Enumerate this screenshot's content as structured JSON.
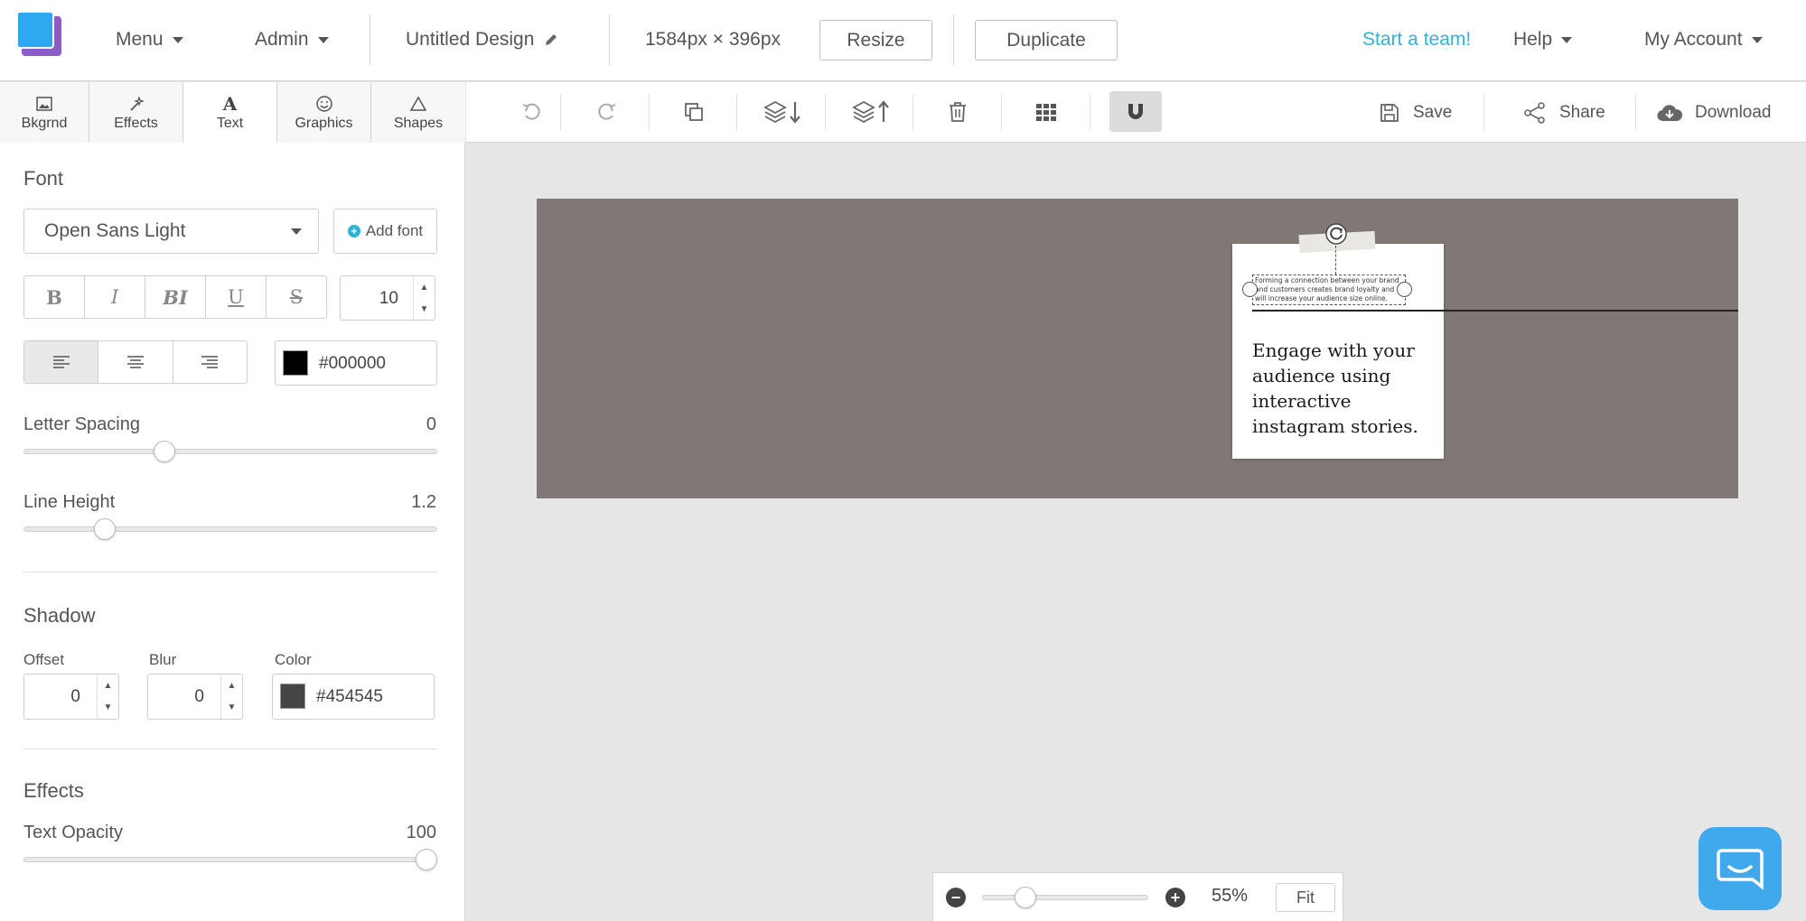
{
  "header": {
    "menu_label": "Menu",
    "admin_label": "Admin",
    "design_title": "Untitled Design",
    "dimensions": "1584px × 396px",
    "resize_label": "Resize",
    "duplicate_label": "Duplicate",
    "team_link": "Start a team!",
    "help_label": "Help",
    "account_label": "My Account"
  },
  "tabs": [
    {
      "label": "Bkgrnd",
      "icon": "image-icon"
    },
    {
      "label": "Effects",
      "icon": "magic-wand-icon"
    },
    {
      "label": "Text",
      "icon": "text-icon"
    },
    {
      "label": "Graphics",
      "icon": "smiley-icon"
    },
    {
      "label": "Shapes",
      "icon": "triangle-icon"
    }
  ],
  "font_panel": {
    "title": "Font",
    "font_name": "Open Sans Light",
    "add_font_label": "Add font",
    "style_buttons": [
      "B",
      "I",
      "BI",
      "U",
      "S"
    ],
    "font_size": "10",
    "color_hex": "#000000",
    "letter_spacing_label": "Letter Spacing",
    "letter_spacing_value": "0",
    "line_height_label": "Line Height",
    "line_height_value": "1.2"
  },
  "shadow_panel": {
    "title": "Shadow",
    "offset_label": "Offset",
    "offset_value": "0",
    "blur_label": "Blur",
    "blur_value": "0",
    "color_label": "Color",
    "color_hex": "#454545"
  },
  "effects_panel": {
    "title": "Effects",
    "opacity_label": "Text Opacity",
    "opacity_value": "100"
  },
  "toolbar": {
    "save_label": "Save",
    "share_label": "Share",
    "download_label": "Download"
  },
  "canvas": {
    "background_color": "#807875",
    "small_text": "Forming a connection between your brand and customers creates brand loyalty and will increase your audience size online.",
    "big_text": "Engage with your audience using interactive instagram stories."
  },
  "zoom": {
    "value": "55%",
    "fit_label": "Fit"
  },
  "colors": {
    "accent": "#2eb3d6",
    "chat": "#3fa9ec"
  }
}
